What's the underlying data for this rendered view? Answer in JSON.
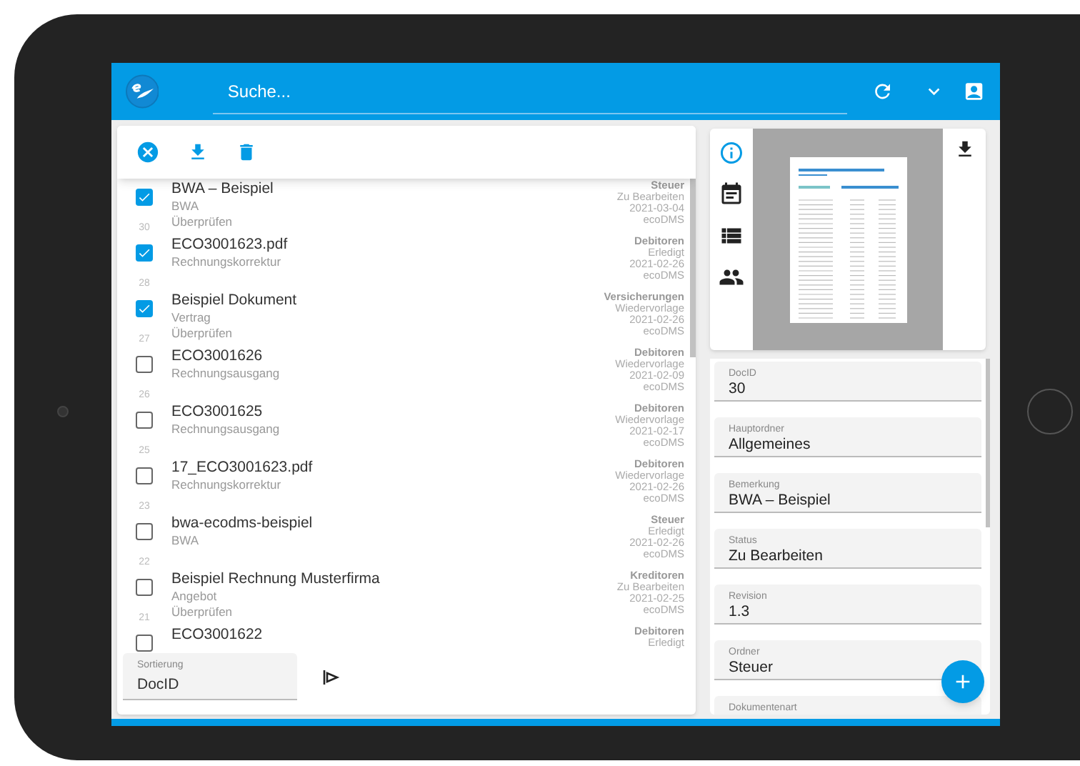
{
  "header": {
    "search_placeholder": "Suche..."
  },
  "documents": [
    {
      "title": "BWA – Beispiel",
      "lines": [
        "BWA",
        "Überprüfen"
      ],
      "number": "30",
      "meta": [
        "Steuer",
        "Zu Bearbeiten",
        "2021-03-04",
        "ecoDMS"
      ],
      "checked": true
    },
    {
      "title": "ECO3001623.pdf",
      "lines": [
        "Rechnungskorrektur"
      ],
      "number": "28",
      "meta": [
        "Debitoren",
        "Erledigt",
        "2021-02-26",
        "ecoDMS"
      ],
      "checked": true
    },
    {
      "title": "Beispiel Dokument",
      "lines": [
        "Vertrag",
        "Überprüfen"
      ],
      "number": "27",
      "meta": [
        "Versicherungen",
        "Wiedervorlage",
        "2021-02-26",
        "ecoDMS"
      ],
      "checked": true
    },
    {
      "title": "ECO3001626",
      "lines": [
        "Rechnungsausgang"
      ],
      "number": "26",
      "meta": [
        "Debitoren",
        "Wiedervorlage",
        "2021-02-09",
        "ecoDMS"
      ],
      "checked": false
    },
    {
      "title": "ECO3001625",
      "lines": [
        "Rechnungsausgang"
      ],
      "number": "25",
      "meta": [
        "Debitoren",
        "Wiedervorlage",
        "2021-02-17",
        "ecoDMS"
      ],
      "checked": false
    },
    {
      "title": "17_ECO3001623.pdf",
      "lines": [
        "Rechnungskorrektur"
      ],
      "number": "23",
      "meta": [
        "Debitoren",
        "Wiedervorlage",
        "2021-02-26",
        "ecoDMS"
      ],
      "checked": false
    },
    {
      "title": "bwa-ecodms-beispiel",
      "lines": [
        "BWA"
      ],
      "number": "22",
      "meta": [
        "Steuer",
        "Erledigt",
        "2021-02-26",
        "ecoDMS"
      ],
      "checked": false
    },
    {
      "title": "Beispiel Rechnung Musterfirma",
      "lines": [
        "Angebot",
        "Überprüfen"
      ],
      "number": "21",
      "meta": [
        "Kreditoren",
        "Zu Bearbeiten",
        "2021-02-25",
        "ecoDMS"
      ],
      "checked": false
    },
    {
      "title": "ECO3001622",
      "meta": [
        "Debitoren",
        "Erledigt"
      ],
      "checked": false
    }
  ],
  "sort": {
    "label": "Sortierung",
    "value": "DocID"
  },
  "detail_tabs": [
    {
      "kind": "info",
      "selected": true
    },
    {
      "kind": "calendar",
      "selected": false
    },
    {
      "kind": "list",
      "selected": false
    },
    {
      "kind": "people",
      "selected": false
    }
  ],
  "fields": [
    {
      "label": "DocID",
      "value": "30"
    },
    {
      "label": "Hauptordner",
      "value": "Allgemeines"
    },
    {
      "label": "Bemerkung",
      "value": "BWA – Beispiel"
    },
    {
      "label": "Status",
      "value": "Zu Bearbeiten"
    },
    {
      "label": "Revision",
      "value": "1.3"
    },
    {
      "label": "Ordner",
      "value": "Steuer"
    },
    {
      "label": "Dokumentenart"
    }
  ]
}
